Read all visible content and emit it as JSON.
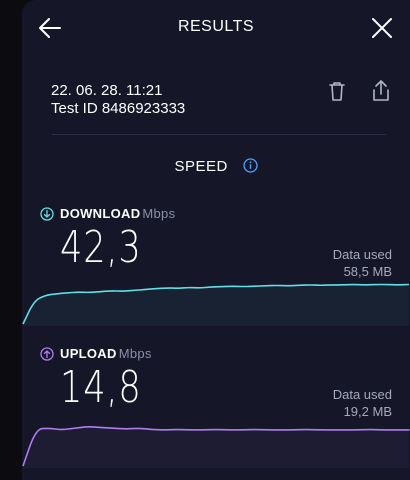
{
  "header": {
    "title": "RESULTS",
    "back_icon": "arrow-left-icon",
    "close_icon": "close-icon"
  },
  "result": {
    "date": "22. 06. 28. 11:21",
    "test_id": "Test ID 8486923333",
    "delete_icon": "trash-icon",
    "share_icon": "share-icon"
  },
  "speed": {
    "title": "SPEED",
    "info_icon": "info-icon"
  },
  "download": {
    "label": "DOWNLOAD",
    "unit": "Mbps",
    "value": "42,3",
    "data_used_label": "Data used",
    "data_used_value": "58,5 MB",
    "color": "#5ee0e6",
    "trace": [
      0,
      0.55,
      0.68,
      0.72,
      0.74,
      0.76,
      0.75,
      0.77,
      0.79,
      0.78,
      0.8,
      0.82,
      0.84,
      0.86,
      0.85,
      0.87,
      0.86,
      0.88,
      0.89,
      0.9,
      0.89,
      0.9,
      0.91,
      0.92,
      0.91,
      0.92,
      0.93,
      0.92,
      0.93,
      0.93,
      0.94,
      0.93,
      0.94,
      0.94,
      0.93,
      0.94
    ]
  },
  "upload": {
    "label": "UPLOAD",
    "unit": "Mbps",
    "value": "14,8",
    "data_used_label": "Data used",
    "data_used_value": "19,2 MB",
    "color": "#b07cf0",
    "trace": [
      0,
      0.88,
      0.9,
      0.86,
      0.9,
      0.94,
      0.92,
      0.9,
      0.88,
      0.9,
      0.87,
      0.86,
      0.87,
      0.86,
      0.86,
      0.87,
      0.86,
      0.86,
      0.87,
      0.86,
      0.86,
      0.86,
      0.87,
      0.86,
      0.86,
      0.86,
      0.86,
      0.87,
      0.86,
      0.86,
      0.86
    ]
  }
}
